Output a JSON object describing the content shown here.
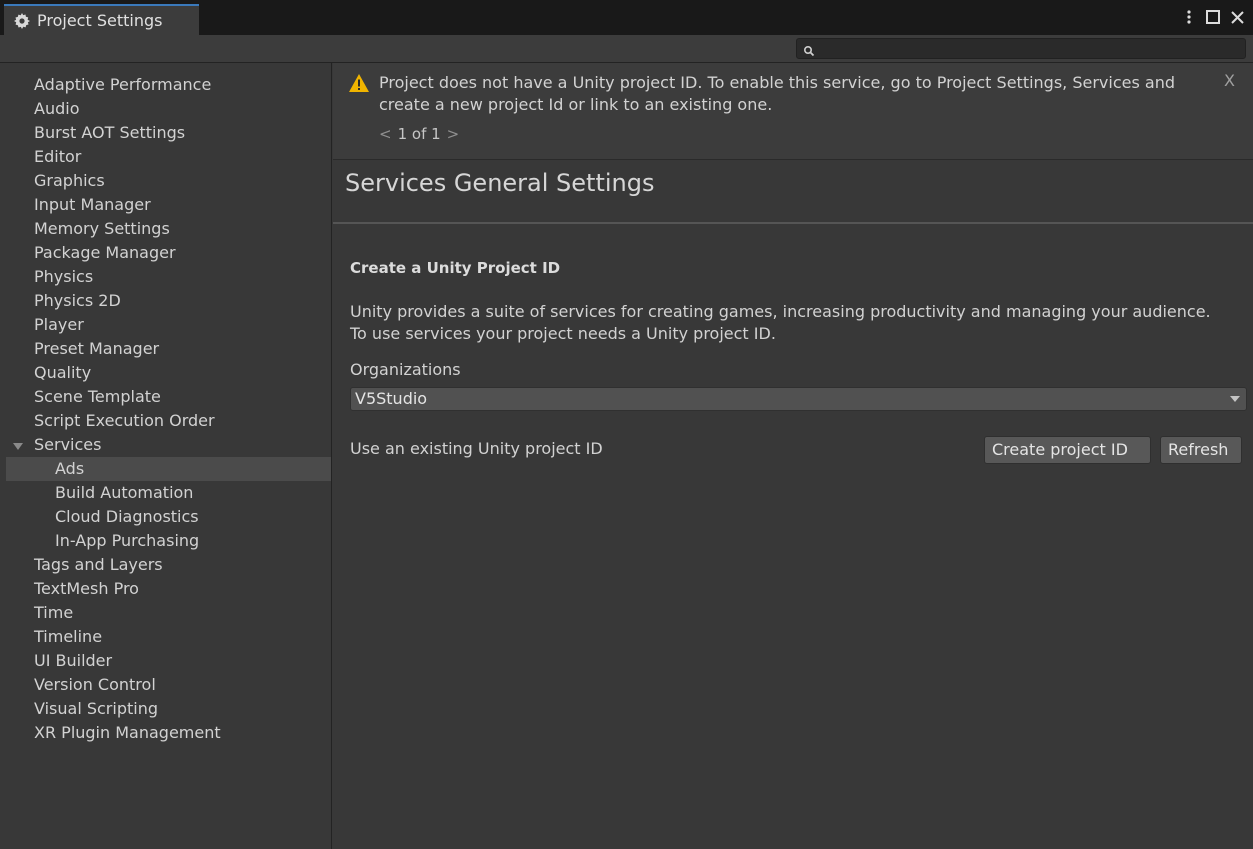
{
  "window": {
    "tab_title": "Project Settings",
    "tab_icon": "gear-icon",
    "controls": [
      "more-options-icon",
      "maximize-icon",
      "close-icon"
    ]
  },
  "search": {
    "placeholder": ""
  },
  "sidebar": {
    "items": [
      {
        "label": "Adaptive Performance"
      },
      {
        "label": "Audio"
      },
      {
        "label": "Burst AOT Settings"
      },
      {
        "label": "Editor"
      },
      {
        "label": "Graphics"
      },
      {
        "label": "Input Manager"
      },
      {
        "label": "Memory Settings"
      },
      {
        "label": "Package Manager"
      },
      {
        "label": "Physics"
      },
      {
        "label": "Physics 2D"
      },
      {
        "label": "Player"
      },
      {
        "label": "Preset Manager"
      },
      {
        "label": "Quality"
      },
      {
        "label": "Scene Template"
      },
      {
        "label": "Script Execution Order"
      },
      {
        "label": "Services",
        "expanded": true
      },
      {
        "label": "Ads",
        "sub": true,
        "selected": true
      },
      {
        "label": "Build Automation",
        "sub": true
      },
      {
        "label": "Cloud Diagnostics",
        "sub": true
      },
      {
        "label": "In-App Purchasing",
        "sub": true
      },
      {
        "label": "Tags and Layers"
      },
      {
        "label": "TextMesh Pro"
      },
      {
        "label": "Time"
      },
      {
        "label": "Timeline"
      },
      {
        "label": "UI Builder"
      },
      {
        "label": "Version Control"
      },
      {
        "label": "Visual Scripting"
      },
      {
        "label": "XR Plugin Management"
      }
    ]
  },
  "banner": {
    "icon": "warning-icon",
    "message": "Project does not have a Unity project ID. To enable this service, go to Project Settings, Services and create a new project Id or link to an existing one.",
    "close": "X",
    "pager_prev": "<",
    "pager_text": "1 of 1",
    "pager_next": ">"
  },
  "main": {
    "title": "Services General Settings",
    "section_title": "Create a Unity Project ID",
    "description": "Unity provides a suite of services for creating games, increasing productivity and managing your audience. To use services your project needs a Unity project ID.",
    "org_label": "Organizations",
    "org_value": "V5Studio",
    "existing_label": "Use an existing Unity project ID",
    "create_button": "Create project ID",
    "refresh_button": "Refresh"
  },
  "colors": {
    "background": "#383838",
    "tab_accent": "#3a79bb",
    "warning": "#f0b400",
    "selected_item": "#4b4b4b"
  }
}
